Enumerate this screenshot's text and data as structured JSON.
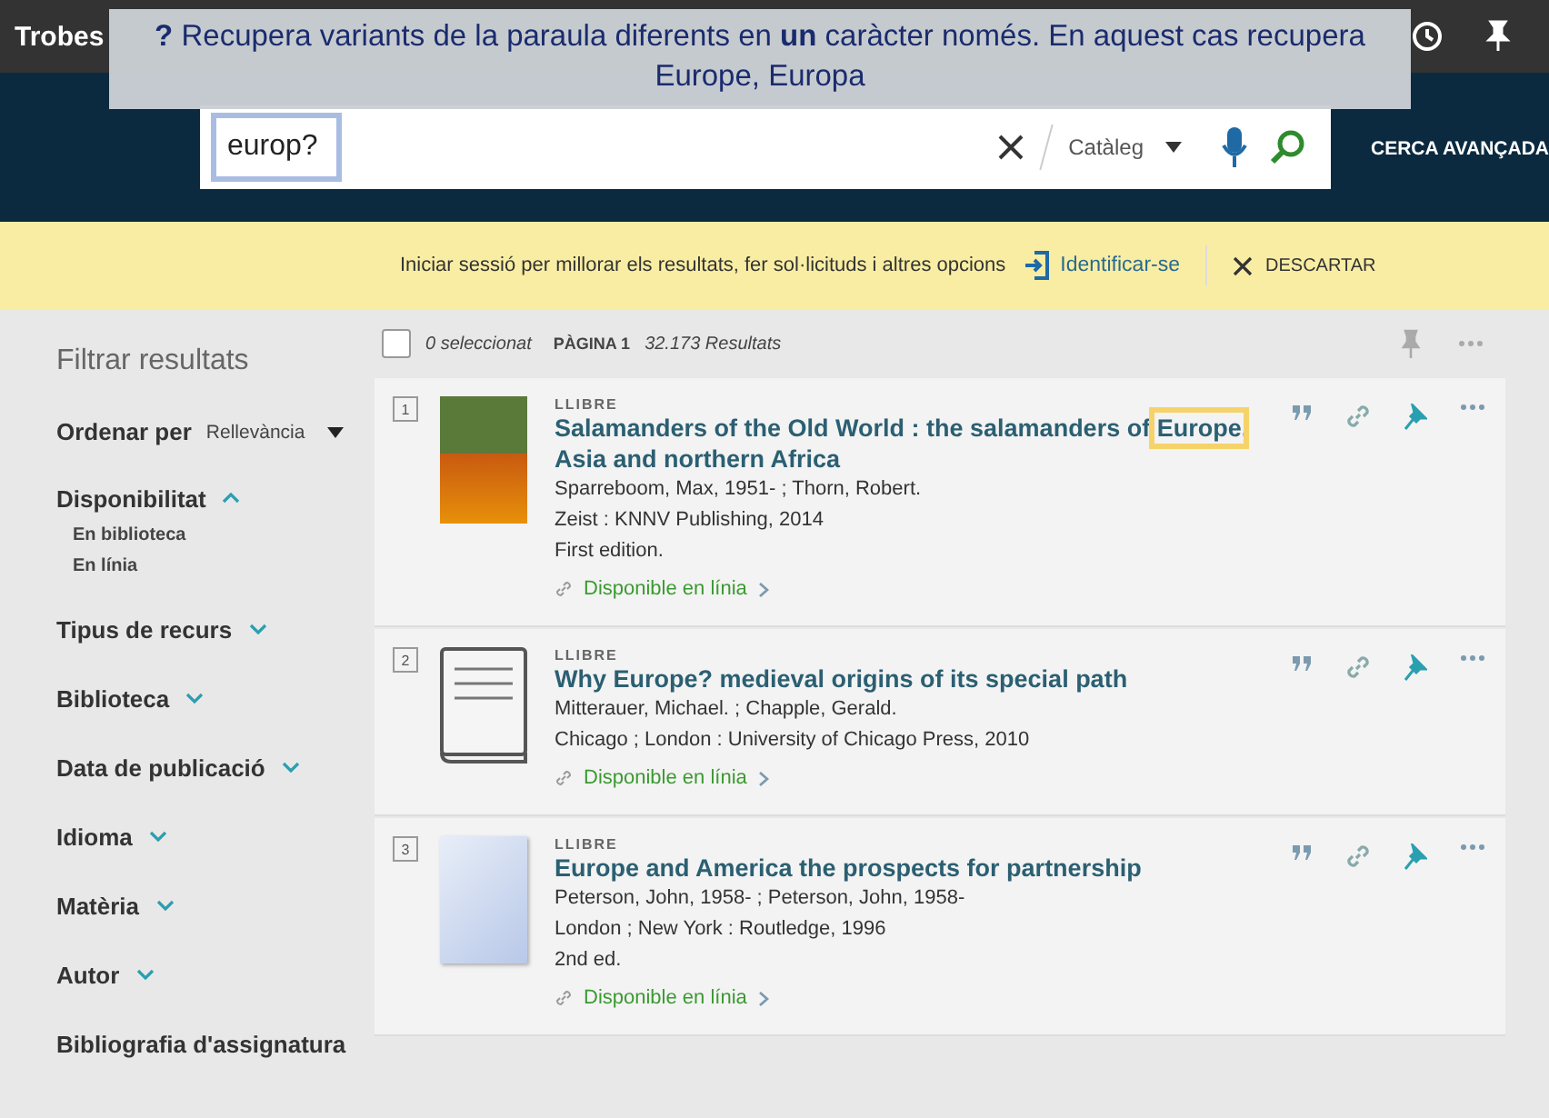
{
  "top_bar": {
    "logo": "Trobes"
  },
  "tooltip": {
    "text": "**?** Recupera variants de la paraula diferents en **un** caràcter només. En aquest cas recupera Europe, Europa"
  },
  "search": {
    "value": "europ?",
    "scope": "Catàleg",
    "advanced": "CERCA AVANÇADA"
  },
  "banner": {
    "text": "Iniciar sessió per millorar els resultats, fer sol·licituds i altres opcions",
    "login": "Identificar-se",
    "dismiss": "DESCARTAR"
  },
  "sidebar": {
    "title": "Filtrar resultats",
    "sort_label": "Ordenar per",
    "sort_value": "Rellevància",
    "facets": [
      {
        "label": "Disponibilitat",
        "expanded": true,
        "children": [
          "En biblioteca",
          "En línia"
        ]
      },
      {
        "label": "Tipus de recurs",
        "expanded": false
      },
      {
        "label": "Biblioteca",
        "expanded": false
      },
      {
        "label": "Data de publicació",
        "expanded": false
      },
      {
        "label": "Idioma",
        "expanded": false
      },
      {
        "label": "Matèria",
        "expanded": false
      },
      {
        "label": "Autor",
        "expanded": false
      },
      {
        "label": "Bibliografia d'assignatura"
      }
    ]
  },
  "results_header": {
    "selected": "0 seleccionat",
    "page": "PÀGINA 1",
    "count": "32.173 Resultats",
    "checked": false
  },
  "results": [
    {
      "number": "1",
      "type": "LLIBRE",
      "kind": "photo",
      "title": [
        {
          "text": "Salamanders of the Old World : the salamanders of ",
          "highlighted": false
        },
        {
          "text": "Europe",
          "highlighted": true
        },
        {
          "text": ", Asia and northern Africa",
          "highlighted": false
        }
      ],
      "lines": [
        "Sparreboom, Max, 1951- ; Thorn, Robert.",
        "Zeist : KNNV Publishing, 2014",
        "First edition."
      ],
      "availability": "Disponible en línia"
    },
    {
      "number": "2",
      "type": "LLIBRE",
      "kind": "book",
      "title": [
        {
          "text": "Why Europe? medieval origins of its special path"
        }
      ],
      "lines": [
        "Mitterauer, Michael. ; Chapple, Gerald.",
        "Chicago ; London : University of Chicago Press, 2010"
      ],
      "availability": "Disponible en línia"
    },
    {
      "number": "3",
      "type": "LLIBRE",
      "kind": "photo",
      "title": [
        {
          "text": "Europe and America the prospects for partnership"
        }
      ],
      "lines": [
        "Peterson, John, 1958- ; Peterson, John, 1958-",
        "London ; New York : Routledge, 1996",
        "2nd ed."
      ],
      "availability": "Disponible en línia"
    }
  ]
}
